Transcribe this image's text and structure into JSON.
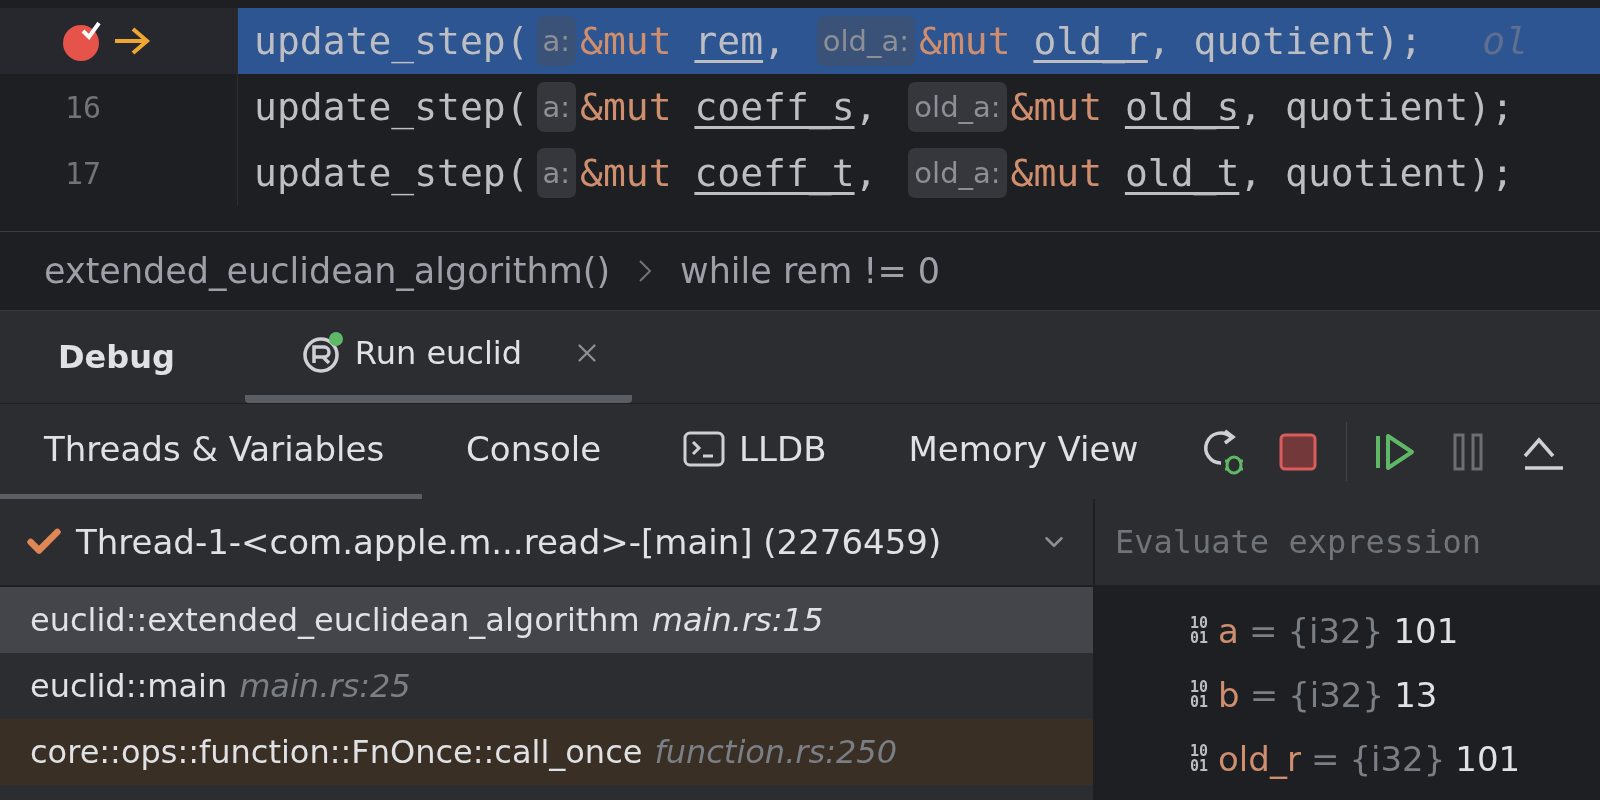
{
  "editor": {
    "lines": [
      {
        "breakpoint": true,
        "current": true,
        "tokens": [
          {
            "kind": "text",
            "text": "update_step("
          },
          {
            "kind": "hint",
            "text": "a:"
          },
          {
            "kind": "keyword",
            "text": "&mut"
          },
          {
            "kind": "var",
            "text": "rem"
          },
          {
            "kind": "text",
            "text": ", "
          },
          {
            "kind": "hint",
            "text": "old_a:"
          },
          {
            "kind": "keyword",
            "text": "&mut"
          },
          {
            "kind": "var",
            "text": "old_r"
          },
          {
            "kind": "text",
            "text": ", quotient);"
          },
          {
            "kind": "inline",
            "text": "ol"
          }
        ]
      },
      {
        "number": "16",
        "breakpoint": false,
        "current": false,
        "tokens": [
          {
            "kind": "text",
            "text": "update_step("
          },
          {
            "kind": "hint",
            "text": "a:"
          },
          {
            "kind": "keyword",
            "text": "&mut"
          },
          {
            "kind": "var",
            "text": "coeff_s"
          },
          {
            "kind": "text",
            "text": ", "
          },
          {
            "kind": "hint",
            "text": "old_a:"
          },
          {
            "kind": "keyword",
            "text": "&mut"
          },
          {
            "kind": "var",
            "text": "old_s"
          },
          {
            "kind": "text",
            "text": ", quotient);"
          }
        ]
      },
      {
        "number": "17",
        "breakpoint": false,
        "current": false,
        "tokens": [
          {
            "kind": "text",
            "text": "update_step("
          },
          {
            "kind": "hint",
            "text": "a:"
          },
          {
            "kind": "keyword",
            "text": "&mut"
          },
          {
            "kind": "var",
            "text": "coeff_t"
          },
          {
            "kind": "text",
            "text": ", "
          },
          {
            "kind": "hint",
            "text": "old_a:"
          },
          {
            "kind": "keyword",
            "text": "&mut"
          },
          {
            "kind": "var",
            "text": "old_t"
          },
          {
            "kind": "text",
            "text": ", quotient);"
          }
        ]
      }
    ]
  },
  "breadcrumbs": [
    "extended_euclidean_algorithm()",
    "while rem != 0"
  ],
  "debug": {
    "title": "Debug",
    "session_tab": {
      "label": "Run euclid",
      "selected": true
    }
  },
  "subtabs": [
    {
      "label": "Threads & Variables",
      "selected": true,
      "kind": "plain"
    },
    {
      "label": "Console",
      "selected": false,
      "kind": "plain"
    },
    {
      "label": "LLDB",
      "selected": false,
      "kind": "terminal"
    },
    {
      "label": "Memory View",
      "selected": false,
      "kind": "plain"
    }
  ],
  "toolbar": [
    {
      "kind": "rerun",
      "disabled": false
    },
    {
      "kind": "stop",
      "disabled": false
    },
    {
      "kind": "resume",
      "disabled": false
    },
    {
      "kind": "pause",
      "disabled": true
    },
    {
      "kind": "step",
      "disabled": false
    }
  ],
  "thread": {
    "label": "Thread-1-<com.apple.m...read>-[main] (2276459)"
  },
  "frames": [
    {
      "name": "euclid::extended_euclidean_algorithm",
      "location": "main.rs:15",
      "selected": true,
      "kind": "user"
    },
    {
      "name": "euclid::main",
      "location": "main.rs:25",
      "selected": false,
      "kind": "user"
    },
    {
      "name": "core::ops::function::FnOnce::call_once",
      "location": "function.rs:250",
      "selected": false,
      "kind": "library"
    }
  ],
  "evaluate": {
    "placeholder": "Evaluate expression"
  },
  "variables": [
    {
      "badge": [
        "10",
        "01"
      ],
      "name": "a",
      "eq": "=",
      "type": "{i32}",
      "value": "101"
    },
    {
      "badge": [
        "10",
        "01"
      ],
      "name": "b",
      "eq": "=",
      "type": "{i32}",
      "value": "13"
    },
    {
      "badge": [
        "10",
        "01"
      ],
      "name": "old_r",
      "eq": "=",
      "type": "{i32}",
      "value": "101"
    }
  ]
}
